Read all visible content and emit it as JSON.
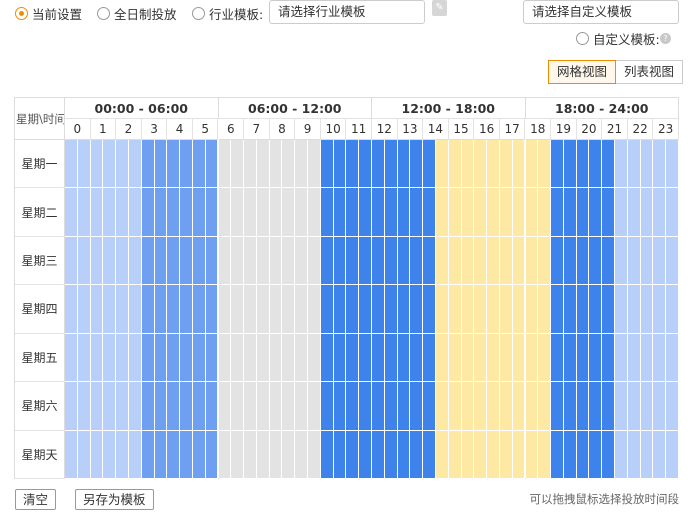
{
  "template_options": [
    {
      "label": "当前设置",
      "selected": true
    },
    {
      "label": "全日制投放",
      "selected": false
    },
    {
      "label": "行业模板:",
      "selected": false
    }
  ],
  "industry_select_placeholder": "请选择行业模板",
  "lock_icon": "lock-icon",
  "custom_select_placeholder": "请选择自定义模板",
  "custom_template_label": "自定义模板:",
  "help_icon": "help-icon",
  "view_tabs": [
    {
      "label": "网格视图",
      "active": true
    },
    {
      "label": "列表视图",
      "active": false
    }
  ],
  "grid": {
    "corner_label": "星期\\时间",
    "ranges": [
      "00:00 - 06:00",
      "06:00 - 12:00",
      "12:00 - 18:00",
      "18:00 - 24:00"
    ],
    "hours": [
      "0",
      "1",
      "2",
      "3",
      "4",
      "5",
      "6",
      "7",
      "8",
      "9",
      "10",
      "11",
      "12",
      "13",
      "14",
      "15",
      "16",
      "17",
      "18",
      "19",
      "20",
      "21",
      "22",
      "23"
    ],
    "days": [
      "星期一",
      "星期二",
      "星期三",
      "星期四",
      "星期五",
      "星期六",
      "星期天"
    ],
    "halfhour_slots_per_day": 48,
    "column_pattern": [
      "L",
      "L",
      "L",
      "L",
      "L",
      "L",
      "M",
      "M",
      "M",
      "M",
      "M",
      "M",
      "G",
      "G",
      "G",
      "G",
      "G",
      "G",
      "G",
      "G",
      "D",
      "D",
      "D",
      "D",
      "D",
      "D",
      "D",
      "D",
      "D",
      "Y",
      "Y",
      "Y",
      "Y",
      "Y",
      "Y",
      "Y",
      "Y",
      "Y",
      "D",
      "D",
      "D",
      "D",
      "D",
      "L",
      "L",
      "L",
      "L",
      "L"
    ],
    "colors": {
      "L": "#b7cff9",
      "M": "#6f9ff1",
      "D": "#3e82ec",
      "G": "#e3e3e3",
      "Y": "#fde9a3"
    }
  },
  "buttons": {
    "clear": "清空",
    "save_as_template": "另存为模板"
  },
  "hint": "可以拖拽鼠标选择投放时间段"
}
